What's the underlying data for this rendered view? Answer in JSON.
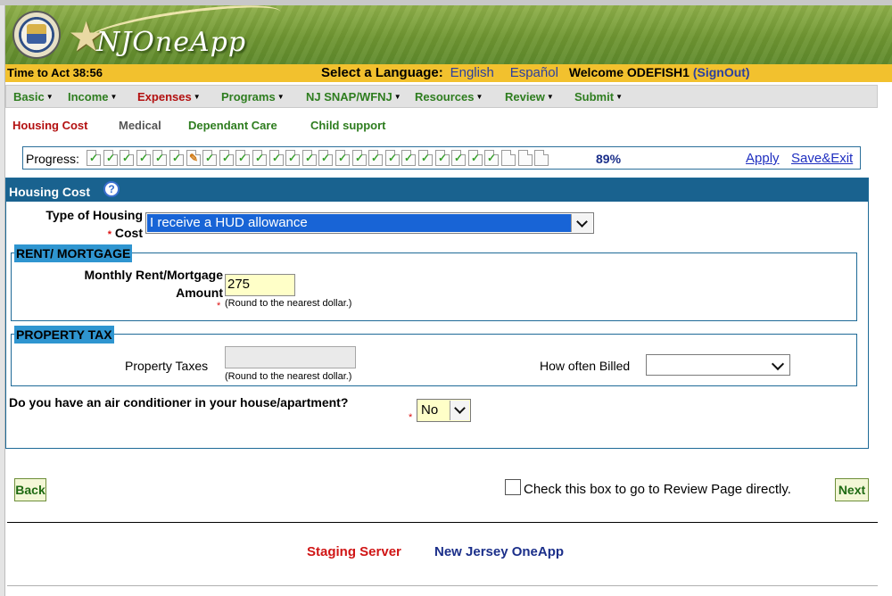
{
  "header": {
    "logo_text": "NJOneApp"
  },
  "language_bar": {
    "timer_text": "Time to Act 38:56",
    "select_language_label": "Select a Language:",
    "languages": [
      "English",
      "Español"
    ],
    "welcome_text": "Welcome ODEFISH1",
    "signout_label": "(SignOut)"
  },
  "menu": {
    "items": [
      {
        "label": "Basic"
      },
      {
        "label": "Income"
      },
      {
        "label": "Expenses"
      },
      {
        "label": "Programs"
      },
      {
        "label": "NJ SNAP/WFNJ"
      },
      {
        "label": "Resources"
      },
      {
        "label": "Review"
      },
      {
        "label": "Submit"
      }
    ],
    "active_index": 2
  },
  "subtabs": {
    "items": [
      "Housing Cost",
      "Medical",
      "Dependant Care",
      "Child support"
    ]
  },
  "progress": {
    "label": "Progress:",
    "percent_text": "89%",
    "percent": 89,
    "apply_label": "Apply",
    "save_exit_label": "Save&Exit"
  },
  "panel": {
    "title": "Housing Cost",
    "housing_type": {
      "label_line1": "Type of Housing",
      "label_line2": "Cost",
      "required_mark": "*",
      "value": "I receive a HUD allowance"
    },
    "rent_mortgage": {
      "legend": "RENT/ MORTGAGE",
      "label_line1": "Monthly Rent/Mortgage",
      "label_line2": "Amount",
      "required_mark": "*",
      "value": "275",
      "hint": "(Round to the nearest dollar.)"
    },
    "property_tax": {
      "legend": "PROPERTY TAX",
      "taxes_label": "Property Taxes",
      "taxes_value": "",
      "hint": "(Round to the nearest dollar.)",
      "billed_label": "How often Billed",
      "billed_value": ""
    },
    "air_conditioner": {
      "question": "Do you have an air conditioner in your house/apartment?",
      "required_mark": "*",
      "value": "No"
    }
  },
  "navigation": {
    "back_label": "Back",
    "review_checkbox_label": "Check this box to go to Review Page directly.",
    "next_label": "Next"
  },
  "footer": {
    "staging_text": "Staging Server",
    "app_text": "New Jersey OneApp"
  },
  "colors": {
    "banner_green": "#6f9632",
    "language_bar": "#f2c12e",
    "panel_header": "#19628f",
    "menu_green": "#2e7d1f",
    "active_red": "#b31010",
    "link_blue": "#1f2fc0"
  }
}
